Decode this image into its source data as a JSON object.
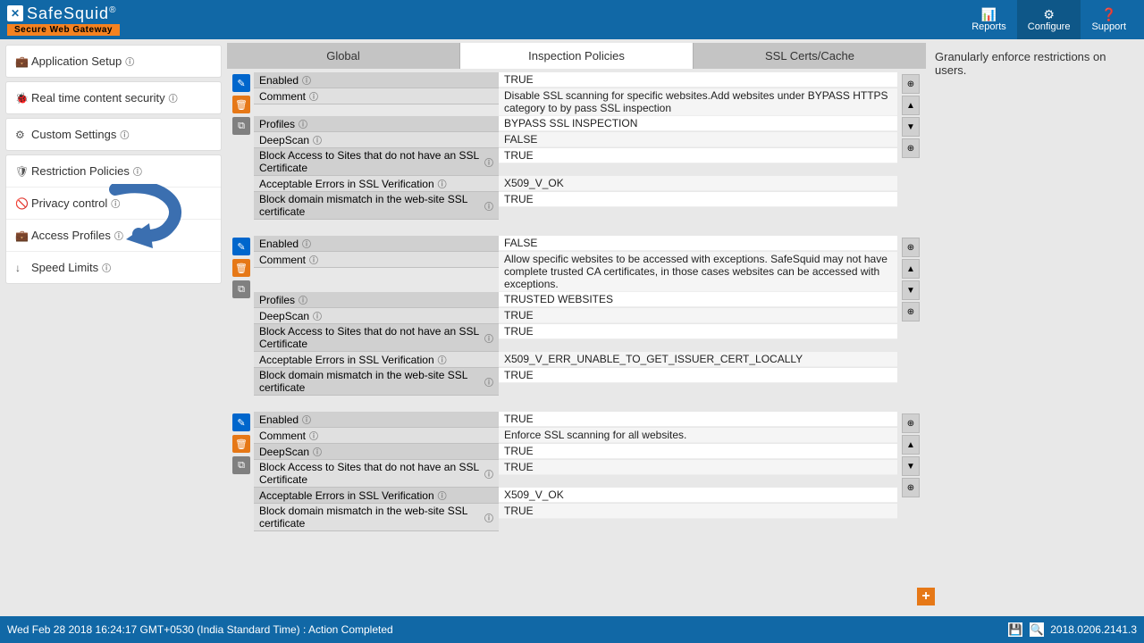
{
  "header": {
    "logo_text": "SafeSquid",
    "logo_r": "®",
    "logo_sub": "Secure Web Gateway",
    "buttons": [
      {
        "icon": "📊",
        "label": "Reports"
      },
      {
        "icon": "⚙",
        "label": "Configure"
      },
      {
        "icon": "❓",
        "label": "Support"
      }
    ]
  },
  "sidebar": {
    "groups": [
      {
        "items": [
          {
            "icon": "💼",
            "label": "Application Setup"
          }
        ]
      },
      {
        "items": [
          {
            "icon": "🐞",
            "label": "Real time content security"
          }
        ]
      },
      {
        "items": [
          {
            "icon": "⚙",
            "label": "Custom Settings"
          }
        ]
      },
      {
        "items": [
          {
            "icon": "🛡",
            "label": "Restriction Policies"
          },
          {
            "icon": "🚫",
            "label": "Privacy control",
            "sub": true
          },
          {
            "icon": "💼",
            "label": "Access Profiles",
            "sub": true
          },
          {
            "icon": "↓",
            "label": "Speed Limits",
            "sub": true
          }
        ]
      }
    ]
  },
  "tabs": [
    "Global",
    "Inspection Policies",
    "SSL Certs/Cache"
  ],
  "active_tab": 1,
  "right_panel": "Granularly enforce restrictions on users.",
  "policies": [
    {
      "rows": [
        [
          "Enabled",
          "TRUE"
        ],
        [
          "Comment",
          "Disable SSL scanning for specific websites.Add websites under BYPASS HTTPS category to by pass SSL inspection"
        ],
        [
          "Profiles",
          "BYPASS SSL INSPECTION"
        ],
        [
          "DeepScan",
          "FALSE"
        ],
        [
          "Block Access to Sites that do not have an SSL Certificate",
          "TRUE"
        ],
        [
          "Acceptable Errors in SSL Verification",
          "X509_V_OK"
        ],
        [
          "Block domain mismatch in the web-site SSL certificate",
          "TRUE"
        ]
      ],
      "side": [
        "⊕",
        "▲",
        "▼",
        "⊕"
      ]
    },
    {
      "rows": [
        [
          "Enabled",
          "FALSE"
        ],
        [
          "Comment",
          "Allow specific websites to be accessed with exceptions. SafeSquid may not have complete trusted CA certificates, in those cases websites can be accessed with exceptions."
        ],
        [
          "Profiles",
          "TRUSTED WEBSITES"
        ],
        [
          "DeepScan",
          "TRUE"
        ],
        [
          "Block Access to Sites that do not have an SSL Certificate",
          "TRUE"
        ],
        [
          "Acceptable Errors in SSL Verification",
          "X509_V_ERR_UNABLE_TO_GET_ISSUER_CERT_LOCALLY"
        ],
        [
          "Block domain mismatch in the web-site SSL certificate",
          "TRUE"
        ]
      ],
      "side": [
        "⊕",
        "▲",
        "▼",
        "⊕"
      ]
    },
    {
      "rows": [
        [
          "Enabled",
          "TRUE"
        ],
        [
          "Comment",
          "Enforce SSL scanning for all websites."
        ],
        [
          "DeepScan",
          "TRUE"
        ],
        [
          "Block Access to Sites that do not have an SSL Certificate",
          "TRUE"
        ],
        [
          "Acceptable Errors in SSL Verification",
          "X509_V_OK"
        ],
        [
          "Block domain mismatch in the web-site SSL certificate",
          "TRUE"
        ]
      ],
      "side": [
        "⊕",
        "▲",
        "▼",
        "⊕"
      ]
    }
  ],
  "footer": {
    "status": "Wed Feb 28 2018 16:24:17 GMT+0530 (India Standard Time) : Action Completed",
    "version": "2018.0206.2141.3"
  }
}
